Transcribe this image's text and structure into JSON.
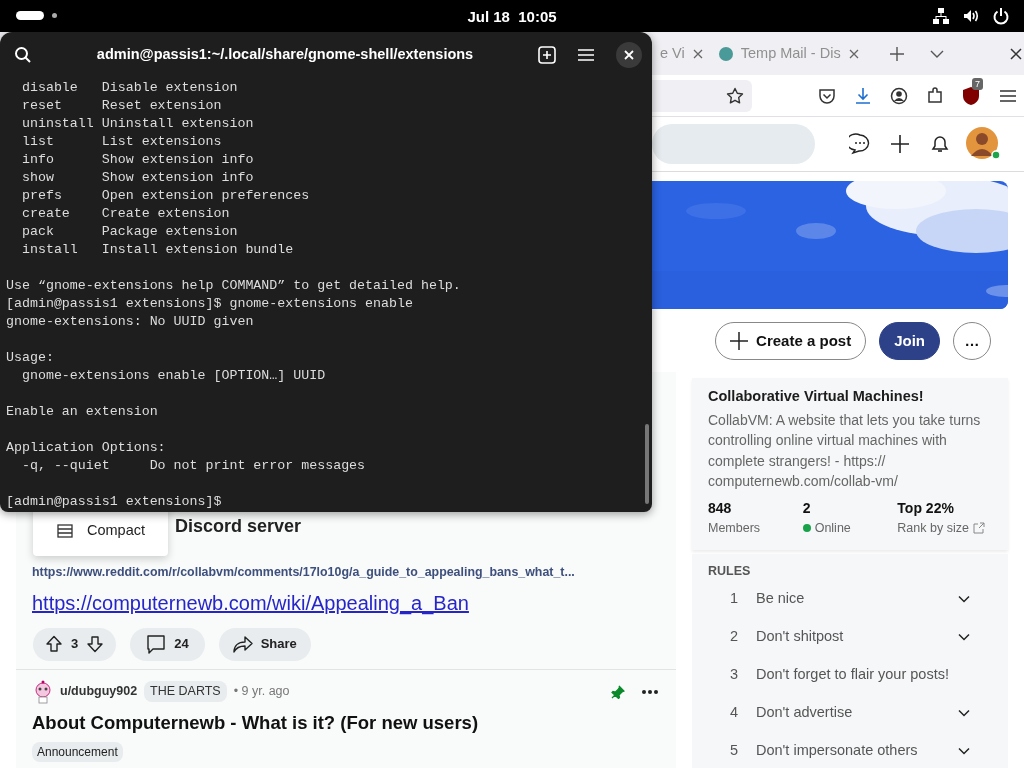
{
  "top_bar": {
    "clock": "Jul 18  10:05"
  },
  "terminal": {
    "title": "admin@passis1:~/.local/share/gnome-shell/extensions",
    "blocks": [
      [
        "  disable   Disable extension",
        "  reset     Reset extension",
        "  uninstall Uninstall extension",
        "  list      List extensions",
        "  info      Show extension info",
        "  show      Show extension info",
        "  prefs     Open extension preferences",
        "  create    Create extension",
        "  pack      Package extension",
        "  install   Install extension bundle"
      ],
      [
        "Use “gnome-extensions help COMMAND” to get detailed help.",
        "[admin@passis1 extensions]$ gnome-extensions enable",
        "gnome-extensions: No UUID given"
      ],
      [
        "Usage:",
        "  gnome-extensions enable [OPTION…] UUID"
      ],
      [
        "Enable an extension"
      ],
      [
        "Application Options:",
        "  -q, --quiet     Do not print error messages"
      ],
      [
        "[admin@passis1 extensions]$ "
      ]
    ]
  },
  "browser": {
    "tabs": [
      {
        "label": "e Vi",
        "selected": false
      },
      {
        "label": "Temp Mail - Dis",
        "selected": false
      }
    ],
    "extension_badge": "7",
    "community": {
      "buttons": [
        {
          "kind": "create",
          "label": "Create a post"
        },
        {
          "kind": "join",
          "label": "Join"
        },
        {
          "kind": "more",
          "label": "…"
        }
      ]
    },
    "sidebar": {
      "title": "Collaborative Virtual Machines!",
      "description": "CollabVM: A website that lets you take turns controlling online virtual machines with complete strangers! - https:// computernewb.com/collab-vm/",
      "stats": [
        {
          "kind": "plain",
          "value": "848",
          "label": "Members"
        },
        {
          "kind": "online",
          "value": "2",
          "label": "Online"
        },
        {
          "kind": "rank",
          "value": "Top 22%",
          "label": "Rank by size"
        }
      ],
      "rules_heading": "RULES",
      "rules": [
        {
          "number": "1",
          "text": "Be nice",
          "collapsible": true
        },
        {
          "number": "2",
          "text": "Don't shitpost",
          "collapsible": true
        },
        {
          "number": "3",
          "text": "Don't forget to flair your posts!",
          "collapsible": false
        },
        {
          "number": "4",
          "text": "Don't advertise",
          "collapsible": true
        },
        {
          "number": "5",
          "text": "Don't impersonate others",
          "collapsible": true
        }
      ]
    },
    "post": {
      "heading": "Discord server",
      "view_menu": [
        {
          "label": "Compact"
        }
      ],
      "url_text": "https://www.reddit.com/r/collabvm/comments/17lo10g/a_guide_to_appealing_bans_what_t...",
      "link": "https://computernewb.com/wiki/Appealing_a_Ban",
      "votes": "3",
      "comments": "24",
      "share": "Share"
    },
    "post2": {
      "author": "u/dubguy902",
      "flair": "THE DARTS",
      "time": "• 9 yr. ago",
      "pinned": true,
      "title": "About Computernewb - What is it? (For new users)",
      "tag": "Announcement"
    }
  }
}
